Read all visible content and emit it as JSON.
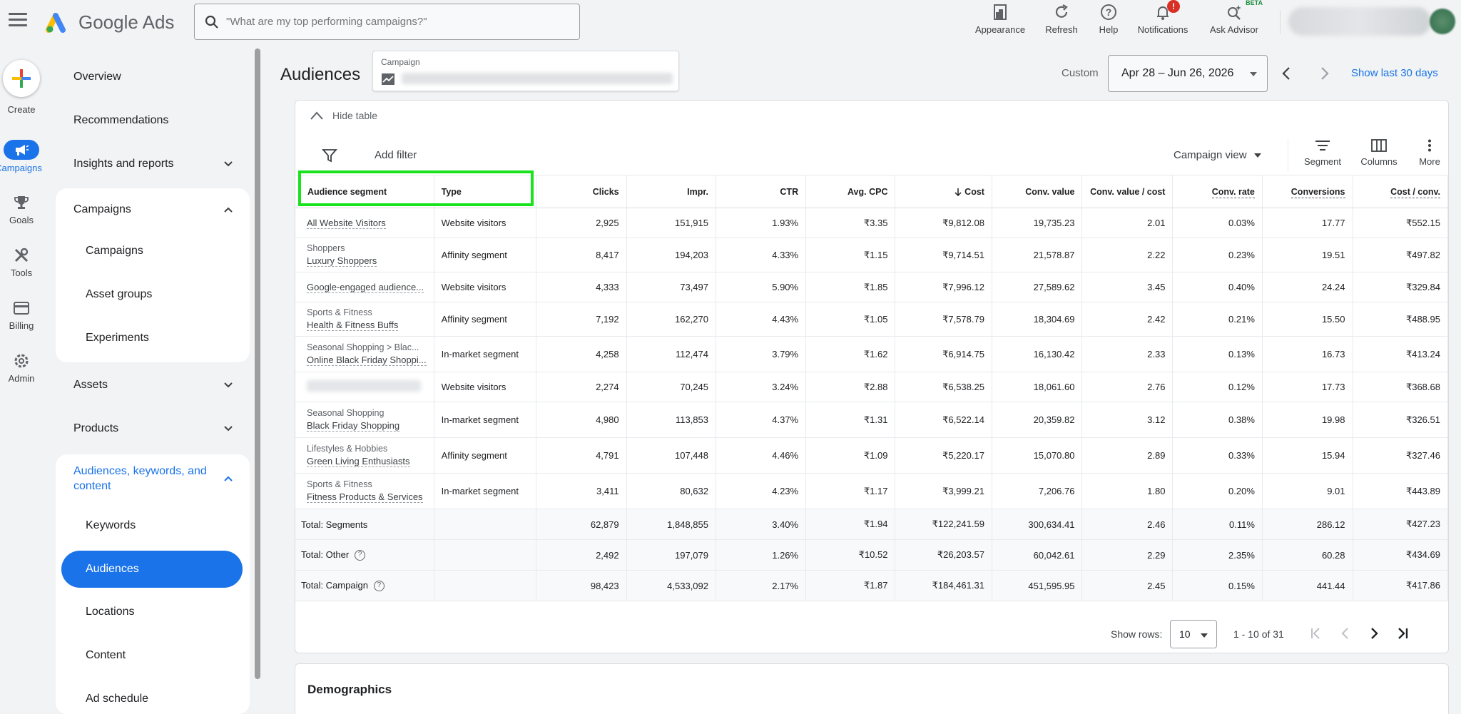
{
  "header": {
    "brand": "Google Ads",
    "search_placeholder": "\"What are my top performing campaigns?\"",
    "tools": [
      {
        "label": "Appearance",
        "icon": "appearance-icon"
      },
      {
        "label": "Refresh",
        "icon": "refresh-icon"
      },
      {
        "label": "Help",
        "icon": "help-icon"
      },
      {
        "label": "Notifications",
        "icon": "bell-icon",
        "badge": "!"
      },
      {
        "label": "Ask Advisor",
        "icon": "advisor-icon",
        "badge": "BETA"
      }
    ]
  },
  "rail": {
    "create": "Create",
    "campaigns": "Campaigns",
    "goals": "Goals",
    "tools": "Tools",
    "billing": "Billing",
    "admin": "Admin"
  },
  "nav": {
    "overview": "Overview",
    "recommendations": "Recommendations",
    "insights": "Insights and reports",
    "campaigns_group": "Campaigns",
    "campaigns_sub": [
      "Campaigns",
      "Asset groups",
      "Experiments"
    ],
    "assets": "Assets",
    "products": "Products",
    "audiences_group": "Audiences, keywords, and content",
    "audiences_sub": [
      "Keywords",
      "Audiences",
      "Locations",
      "Content",
      "Ad schedule"
    ]
  },
  "page": {
    "title": "Audiences",
    "campaign_label": "Campaign",
    "custom_label": "Custom",
    "date_range": "Apr 28 – Jun 26, 2026",
    "show_last": "Show last 30 days"
  },
  "table_toolbar": {
    "hide_table": "Hide table",
    "add_filter": "Add filter",
    "campaign_view": "Campaign view",
    "segment": "Segment",
    "columns": "Columns",
    "more": "More"
  },
  "table": {
    "headers": [
      "Audience segment",
      "Type",
      "Clicks",
      "Impr.",
      "CTR",
      "Avg. CPC",
      "Cost",
      "Conv. value",
      "Conv. value / cost",
      "Conv. rate",
      "Conversions",
      "Cost / conv."
    ],
    "rows": [
      {
        "parent": "",
        "name": "All Website Visitors",
        "type": "Website visitors",
        "clicks": "2,925",
        "impr": "151,915",
        "ctr": "1.93%",
        "cpc": "₹3.35",
        "cost": "₹9,812.08",
        "conv_value": "19,735.23",
        "value_cost": "2.01",
        "conv_rate": "0.03%",
        "conversions": "17.77",
        "cost_conv": "₹552.15"
      },
      {
        "parent": "Shoppers",
        "name": "Luxury Shoppers",
        "type": "Affinity segment",
        "clicks": "8,417",
        "impr": "194,203",
        "ctr": "4.33%",
        "cpc": "₹1.15",
        "cost": "₹9,714.51",
        "conv_value": "21,578.87",
        "value_cost": "2.22",
        "conv_rate": "0.23%",
        "conversions": "19.51",
        "cost_conv": "₹497.82"
      },
      {
        "parent": "",
        "name": "Google-engaged audience...",
        "type": "Website visitors",
        "clicks": "4,333",
        "impr": "73,497",
        "ctr": "5.90%",
        "cpc": "₹1.85",
        "cost": "₹7,996.12",
        "conv_value": "27,589.62",
        "value_cost": "3.45",
        "conv_rate": "0.40%",
        "conversions": "24.24",
        "cost_conv": "₹329.84"
      },
      {
        "parent": "Sports & Fitness",
        "name": "Health & Fitness Buffs",
        "type": "Affinity segment",
        "clicks": "7,192",
        "impr": "162,270",
        "ctr": "4.43%",
        "cpc": "₹1.05",
        "cost": "₹7,578.79",
        "conv_value": "18,304.69",
        "value_cost": "2.42",
        "conv_rate": "0.21%",
        "conversions": "15.50",
        "cost_conv": "₹488.95"
      },
      {
        "parent": "Seasonal Shopping > Blac...",
        "name": "Online Black Friday Shoppi...",
        "type": "In-market segment",
        "clicks": "4,258",
        "impr": "112,474",
        "ctr": "3.79%",
        "cpc": "₹1.62",
        "cost": "₹6,914.75",
        "conv_value": "16,130.42",
        "value_cost": "2.33",
        "conv_rate": "0.13%",
        "conversions": "16.73",
        "cost_conv": "₹413.24"
      },
      {
        "parent": "",
        "name": "",
        "type": "Website visitors",
        "clicks": "2,274",
        "impr": "70,245",
        "ctr": "3.24%",
        "cpc": "₹2.88",
        "cost": "₹6,538.25",
        "conv_value": "18,061.60",
        "value_cost": "2.76",
        "conv_rate": "0.12%",
        "conversions": "17.73",
        "cost_conv": "₹368.68"
      },
      {
        "parent": "Seasonal Shopping",
        "name": "Black Friday Shopping",
        "type": "In-market segment",
        "clicks": "4,980",
        "impr": "113,853",
        "ctr": "4.37%",
        "cpc": "₹1.31",
        "cost": "₹6,522.14",
        "conv_value": "20,359.82",
        "value_cost": "3.12",
        "conv_rate": "0.38%",
        "conversions": "19.98",
        "cost_conv": "₹326.51"
      },
      {
        "parent": "Lifestyles & Hobbies",
        "name": "Green Living Enthusiasts",
        "type": "Affinity segment",
        "clicks": "4,791",
        "impr": "107,448",
        "ctr": "4.46%",
        "cpc": "₹1.09",
        "cost": "₹5,220.17",
        "conv_value": "15,070.80",
        "value_cost": "2.89",
        "conv_rate": "0.33%",
        "conversions": "15.94",
        "cost_conv": "₹327.46"
      },
      {
        "parent": "Sports & Fitness",
        "name": "Fitness Products & Services",
        "type": "In-market segment",
        "clicks": "3,411",
        "impr": "80,632",
        "ctr": "4.23%",
        "cpc": "₹1.17",
        "cost": "₹3,999.21",
        "conv_value": "7,206.76",
        "value_cost": "1.80",
        "conv_rate": "0.20%",
        "conversions": "9.01",
        "cost_conv": "₹443.89"
      }
    ],
    "totals": [
      {
        "label": "Total: Segments",
        "help": false,
        "clicks": "62,879",
        "impr": "1,848,855",
        "ctr": "3.40%",
        "cpc": "₹1.94",
        "cost": "₹122,241.59",
        "conv_value": "300,634.41",
        "value_cost": "2.46",
        "conv_rate": "0.11%",
        "conversions": "286.12",
        "cost_conv": "₹427.23"
      },
      {
        "label": "Total: Other",
        "help": true,
        "clicks": "2,492",
        "impr": "197,079",
        "ctr": "1.26%",
        "cpc": "₹10.52",
        "cost": "₹26,203.57",
        "conv_value": "60,042.61",
        "value_cost": "2.29",
        "conv_rate": "2.35%",
        "conversions": "60.28",
        "cost_conv": "₹434.69"
      },
      {
        "label": "Total: Campaign",
        "help": true,
        "clicks": "98,423",
        "impr": "4,533,092",
        "ctr": "2.17%",
        "cpc": "₹1.87",
        "cost": "₹184,461.31",
        "conv_value": "451,595.95",
        "value_cost": "2.45",
        "conv_rate": "0.15%",
        "conversions": "441.44",
        "cost_conv": "₹417.86"
      }
    ]
  },
  "pager": {
    "show_rows": "Show rows:",
    "rows_value": "10",
    "range": "1 - 10 of 31"
  },
  "demographics": {
    "title": "Demographics"
  },
  "colors": {
    "accent": "#1a73e8",
    "highlight": "#19e31f",
    "badge": "#d93025",
    "beta": "#1e8e3e"
  }
}
